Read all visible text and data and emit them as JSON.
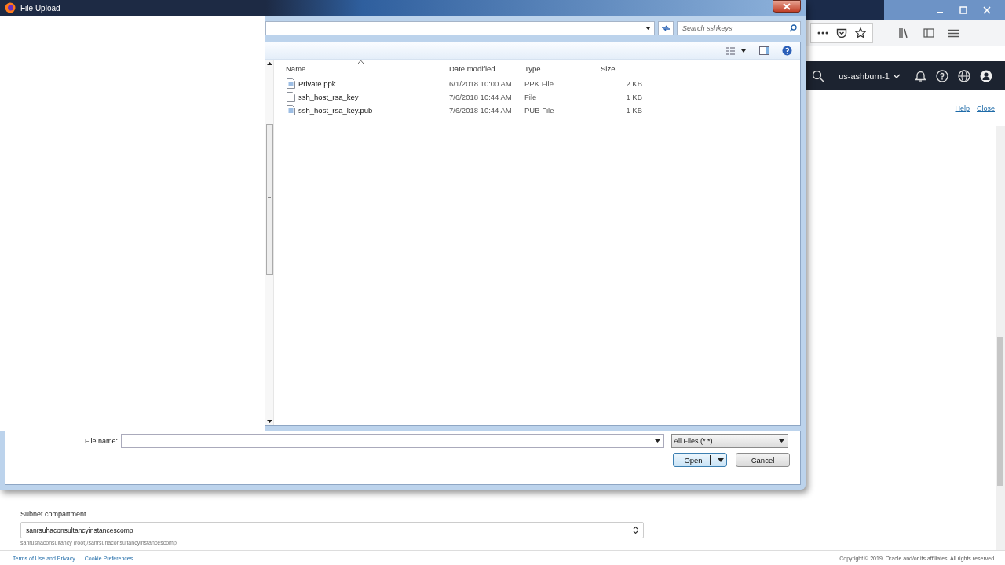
{
  "browser": {
    "region": "us-ashburn-1",
    "links": [
      "Help",
      "Close"
    ]
  },
  "form": {
    "label": "Subnet compartment",
    "value": "sanrsuhaconsultancyinstancescomp",
    "hint": "sanrushaconsultancy (root)/sanrsuhaconsultancyinstancescomp"
  },
  "footer": {
    "links": [
      "Terms of Use and Privacy",
      "Cookie Preferences"
    ],
    "copyright": "Copyright © 2019, Oracle and/or its affiliates. All rights reserved."
  },
  "dialog": {
    "title": "File Upload",
    "search": {
      "placeholder": "Search sshkeys"
    },
    "columns": [
      {
        "label": "Name",
        "sorted": true
      },
      {
        "label": "Date modified",
        "sorted": false
      },
      {
        "label": "Type",
        "sorted": false
      },
      {
        "label": "Size",
        "sorted": false
      }
    ],
    "files": [
      {
        "name": "Private.ppk",
        "date": "6/1/2018 10:00 AM",
        "type": "PPK File",
        "size": "2 KB",
        "kind": "document"
      },
      {
        "name": "ssh_host_rsa_key",
        "date": "7/6/2018 10:44 AM",
        "type": "File",
        "size": "1 KB",
        "kind": "blank"
      },
      {
        "name": "ssh_host_rsa_key.pub",
        "date": "7/6/2018 10:44 AM",
        "type": "PUB File",
        "size": "1 KB",
        "kind": "document"
      }
    ],
    "file_name": {
      "label": "File name:"
    },
    "filter": "All Files (*.*)",
    "buttons": [
      {
        "label": "Open",
        "kind": "split"
      },
      {
        "label": "Cancel",
        "kind": "plain"
      }
    ]
  }
}
